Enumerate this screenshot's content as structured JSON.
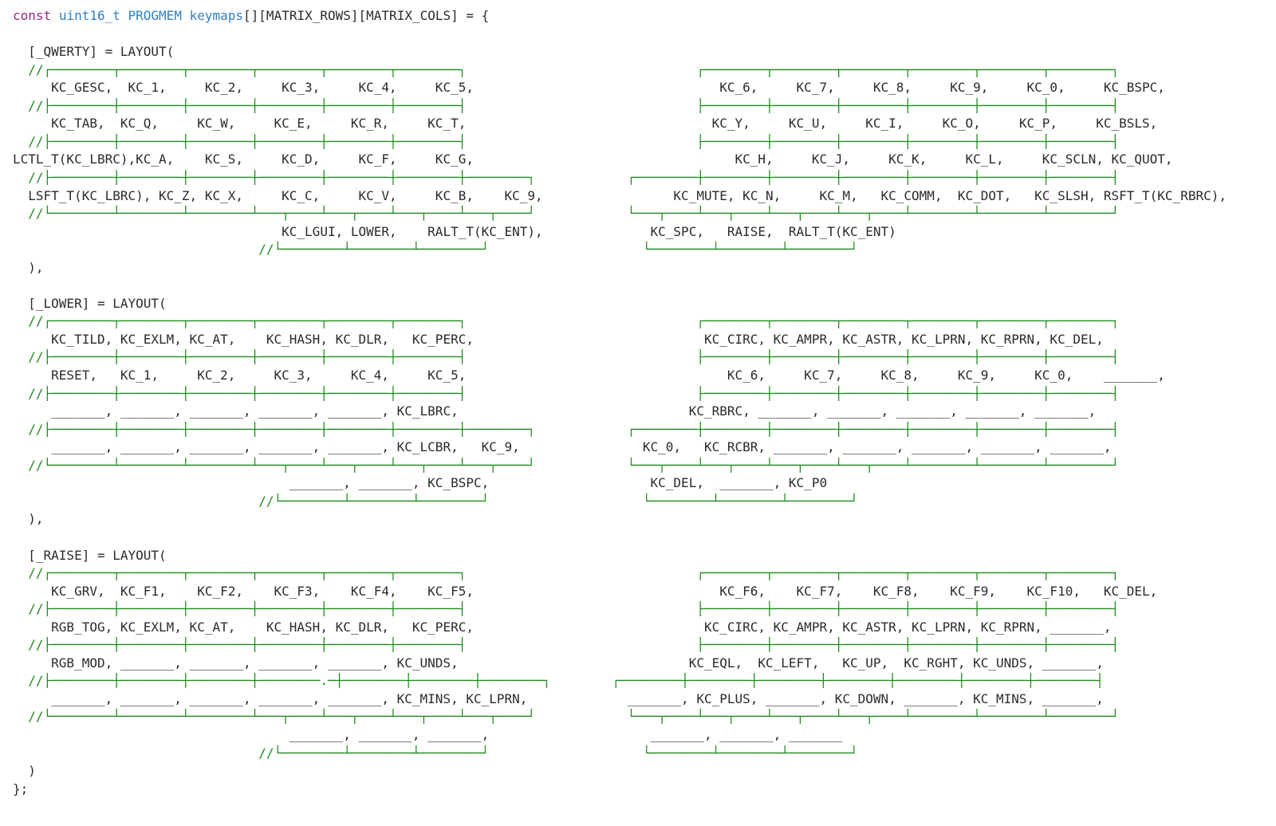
{
  "code": {
    "declaration": {
      "keyword": "const",
      "type": "uint16_t",
      "qualifier": "PROGMEM",
      "name": "keymaps",
      "rest": "[][MATRIX_ROWS][MATRIX_COLS] = {"
    },
    "lines": [
      {
        "c": "",
        "t": ""
      },
      {
        "c": "",
        "t": "  [_QWERTY] = LAYOUT("
      },
      {
        "c": "  //┌────────┬────────┬────────┬────────┬────────┬────────┐                              ┌────────┬────────┬────────┬────────┬────────┬────────┐",
        "t": ""
      },
      {
        "c": "",
        "t": "     KC_GESC,  KC_1,     KC_2,     KC_3,     KC_4,     KC_5,                                KC_6,     KC_7,     KC_8,     KC_9,     KC_0,     KC_BSPC,"
      },
      {
        "c": "  //├────────┼────────┼────────┼────────┼────────┼────────┤                              ├────────┼────────┼────────┼────────┼────────┼────────┤",
        "t": ""
      },
      {
        "c": "",
        "t": "     KC_TAB,  KC_Q,     KC_W,     KC_E,     KC_R,     KC_T,                                KC_Y,     KC_U,     KC_I,     KC_O,     KC_P,     KC_BSLS,"
      },
      {
        "c": "  //├────────┼────────┼────────┼────────┼────────┼────────┤                              ├────────┼────────┼────────┼────────┼────────┼────────┤",
        "t": ""
      },
      {
        "c": "",
        "t": "LCTL_T(KC_LBRC),KC_A,    KC_S,     KC_D,     KC_F,     KC_G,                                  KC_H,     KC_J,     KC_K,     KC_L,     KC_SCLN, KC_QUOT,"
      },
      {
        "c": "  //├────────┼────────┼────────┼────────┼────────┼────────┼────────┐            ┌────────┼────────┼────────┼────────┼────────┼────────┼────────┤",
        "t": ""
      },
      {
        "c": "",
        "t": "  LSFT_T(KC_LBRC), KC_Z, KC_X,     KC_C,     KC_V,     KC_B,    KC_9,                 KC_MUTE, KC_N,     KC_M,   KC_COMM,  KC_DOT,   KC_SLSH, RSFT_T(KC_RBRC),"
      },
      {
        "c": "  //└────────┴────────┴────────┴───┬────┴───┬────┴───┬────┴───┬────┘            └───┬────┴───┬────┴───┬────┴───┬────┴────────┴────────┴────────┘",
        "t": ""
      },
      {
        "c": "",
        "t": "                                   KC_LGUI, LOWER,    RALT_T(KC_ENT),              KC_SPC,   RAISE,  RALT_T(KC_ENT)"
      },
      {
        "c": "                                //└────────┴────────┴────────┘                    └────────┴────────┴────────┘",
        "t": ""
      },
      {
        "c": "",
        "t": "  ),"
      },
      {
        "c": "",
        "t": ""
      },
      {
        "c": "",
        "t": "  [_LOWER] = LAYOUT("
      },
      {
        "c": "  //┌────────┬────────┬────────┬────────┬────────┬────────┐                              ┌────────┬────────┬────────┬────────┬────────┬────────┐",
        "t": ""
      },
      {
        "c": "",
        "t": "     KC_TILD, KC_EXLM, KC_AT,    KC_HASH, KC_DLR,   KC_PERC,                              KC_CIRC, KC_AMPR, KC_ASTR, KC_LPRN, KC_RPRN, KC_DEL,"
      },
      {
        "c": "  //├────────┼────────┼────────┼────────┼────────┼────────┤                              ├────────┼────────┼────────┼────────┼────────┼────────┤",
        "t": ""
      },
      {
        "c": "",
        "t": "     RESET,   KC_1,     KC_2,     KC_3,     KC_4,     KC_5,                                  KC_6,     KC_7,     KC_8,     KC_9,     KC_0,    _______,"
      },
      {
        "c": "  //├────────┼────────┼────────┼────────┼────────┼────────┤                              ├────────┼────────┼────────┼────────┼────────┼────────┤",
        "t": ""
      },
      {
        "c": "",
        "t": "     _______, _______, _______, _______, _______, KC_LBRC,                              KC_RBRC, _______, _______, _______, _______, _______,"
      },
      {
        "c": "  //├────────┼────────┼────────┼────────┼────────┼────────┼────────┐            ┌────────┼────────┼────────┼────────┼────────┼────────┼────────┤",
        "t": ""
      },
      {
        "c": "",
        "t": "     _______, _______, _______, _______, _______, KC_LCBR,   KC_9,                KC_0,   KC_RCBR, _______, _______, _______, _______, _______,"
      },
      {
        "c": "  //└────────┴────────┴────────┴───┬────┴───┬────┴───┬────┴───┬────┘            └───┬────┴───┬────┴───┬────┴───┬────┴────────┴────────┴────────┘",
        "t": ""
      },
      {
        "c": "",
        "t": "                                    _______, _______, KC_BSPC,                     KC_DEL,  _______, KC_P0"
      },
      {
        "c": "                                //└────────┴────────┴────────┘                    └────────┴────────┴────────┘",
        "t": ""
      },
      {
        "c": "",
        "t": "  ),"
      },
      {
        "c": "",
        "t": ""
      },
      {
        "c": "",
        "t": "  [_RAISE] = LAYOUT("
      },
      {
        "c": "  //┌────────┬────────┬────────┬────────┬────────┬────────┐                              ┌────────┬────────┬────────┬────────┬────────┬────────┐",
        "t": ""
      },
      {
        "c": "",
        "t": "     KC_GRV,  KC_F1,    KC_F2,    KC_F3,    KC_F4,    KC_F5,                                KC_F6,    KC_F7,    KC_F8,    KC_F9,    KC_F10,   KC_DEL,"
      },
      {
        "c": "  //├────────┼────────┼────────┼────────┼────────┼────────┤                              ├────────┼────────┼────────┼────────┼────────┼────────┤",
        "t": ""
      },
      {
        "c": "",
        "t": "     RGB_TOG, KC_EXLM, KC_AT,    KC_HASH, KC_DLR,   KC_PERC,                              KC_CIRC, KC_AMPR, KC_ASTR, KC_LPRN, KC_RPRN, _______,"
      },
      {
        "c": "  //├────────┼────────┼────────┼────────┼────────┼────────┤                              ├────────┼────────┼────────┼────────┼────────┼────────┤",
        "t": ""
      },
      {
        "c": "",
        "t": "     RGB_MOD, _______, _______, _______, _______, KC_UNDS,                              KC_EQL,  KC_LEFT,   KC_UP,  KC_RGHT, KC_UNDS, _______,"
      },
      {
        "c": "  //├────────┼────────┼────────┼────────.─┼────────┼────────┼────────┐        ┌────────┼────────┼────────┼────────┼────────┼────────┼────────┤",
        "t": ""
      },
      {
        "c": "",
        "t": "     _______, _______, _______, _______, _______, KC_MINS, KC_LPRN,             _______, KC_PLUS, _______, KC_DOWN, _______, KC_MINS, _______,"
      },
      {
        "c": "  //└────────┴────────┴────────┴───┬────┴───┬────┴───┬────┴───┬────┘            └───┬────┴───┬────┴───┬────┴───┬────┴────────┴────────┴────────┘",
        "t": ""
      },
      {
        "c": "",
        "t": "                                    _______, _______, _______,                     _______, _______, _______"
      },
      {
        "c": "                                //└────────┴────────┴────────┘                    └────────┴────────┴────────┘",
        "t": ""
      },
      {
        "c": "",
        "t": "  )"
      },
      {
        "c": "",
        "t": "};"
      }
    ]
  },
  "colors": {
    "keyword": "#9b2393",
    "type": "#2f7fc1",
    "comment": "#1c8a1c",
    "text": "#2b2b2b",
    "background": "#ffffff"
  }
}
